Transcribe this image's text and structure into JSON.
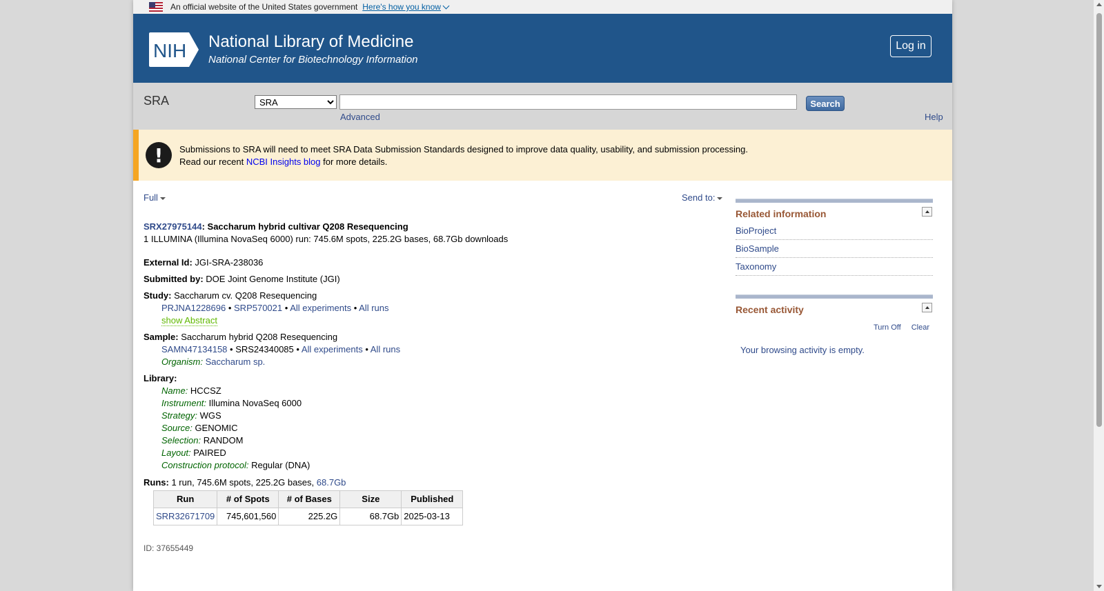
{
  "gov_banner": {
    "text": "An official website of the United States government",
    "link": "Here's how you know"
  },
  "header": {
    "logo_text": "NIH",
    "title": "National Library of Medicine",
    "subtitle": "National Center for Biotechnology Information",
    "login": "Log in"
  },
  "search": {
    "db_name": "SRA",
    "selected_db": "SRA",
    "query": "",
    "button": "Search",
    "advanced": "Advanced",
    "help": "Help"
  },
  "alert": {
    "line1": "Submissions to SRA will need to meet SRA Data Submission Standards designed to improve data quality, usability, and submission processing.",
    "line2_pre": "Read our recent ",
    "line2_link": "NCBI Insights blog",
    "line2_post": " for more details."
  },
  "display": {
    "format": "Full",
    "send_to": "Send to:"
  },
  "record": {
    "accession": "SRX27975144",
    "title": ": Saccharum hybrid cultivar Q208 Resequencing",
    "summary": "1 ILLUMINA (Illumina NovaSeq 6000) run: 745.6M spots, 225.2G bases, 68.7Gb downloads",
    "external_id_label": "External Id:",
    "external_id": "JGI-SRA-238036",
    "submitted_by_label": "Submitted by:",
    "submitted_by": "DOE Joint Genome Institute (JGI)",
    "study_label": "Study:",
    "study": "Saccharum cv. Q208 Resequencing",
    "study_links": {
      "bioproject": "PRJNA1228696",
      "srp": "SRP570021",
      "all_experiments": "All experiments",
      "all_runs": "All runs",
      "show_abstract": "show Abstract"
    },
    "sample_label": "Sample:",
    "sample": "Saccharum hybrid Q208 Resequencing",
    "sample_links": {
      "biosample": "SAMN47134158",
      "srs": "SRS24340085",
      "all_experiments": "All experiments",
      "all_runs": "All runs"
    },
    "organism_label": "Organism:",
    "organism": "Saccharum sp.",
    "library_label": "Library:",
    "library": [
      {
        "label": "Name:",
        "value": "HCCSZ"
      },
      {
        "label": "Instrument:",
        "value": "Illumina NovaSeq 6000"
      },
      {
        "label": "Strategy:",
        "value": "WGS"
      },
      {
        "label": "Source:",
        "value": "GENOMIC"
      },
      {
        "label": "Selection:",
        "value": "RANDOM"
      },
      {
        "label": "Layout:",
        "value": "PAIRED"
      },
      {
        "label": "Construction protocol:",
        "value": "Regular (DNA)"
      }
    ],
    "runs_label": "Runs:",
    "runs_text": "1 run, 745.6M spots, 225.2G bases, ",
    "runs_link": "68.7Gb",
    "bullet": " • ",
    "table": {
      "headers": [
        "Run",
        "# of Spots",
        "# of Bases",
        "Size",
        "Published"
      ],
      "rows": [
        {
          "run": "SRR32671709",
          "spots": "745,601,560",
          "bases": "225.2G",
          "size": "68.7Gb",
          "published": "2025-03-13"
        }
      ]
    },
    "id_line": "ID: 37655449"
  },
  "sidebar": {
    "related_title": "Related information",
    "related_items": [
      "BioProject",
      "BioSample",
      "Taxonomy"
    ],
    "recent_title": "Recent activity",
    "turn_off": "Turn Off",
    "clear": "Clear",
    "empty": "Your browsing activity is empty."
  },
  "colors": {
    "header_bg": "#20558a",
    "alert_bg": "#fcf0d4",
    "alert_border": "#f5a623",
    "link": "#2f4a8a",
    "portlet_title": "#985735"
  }
}
